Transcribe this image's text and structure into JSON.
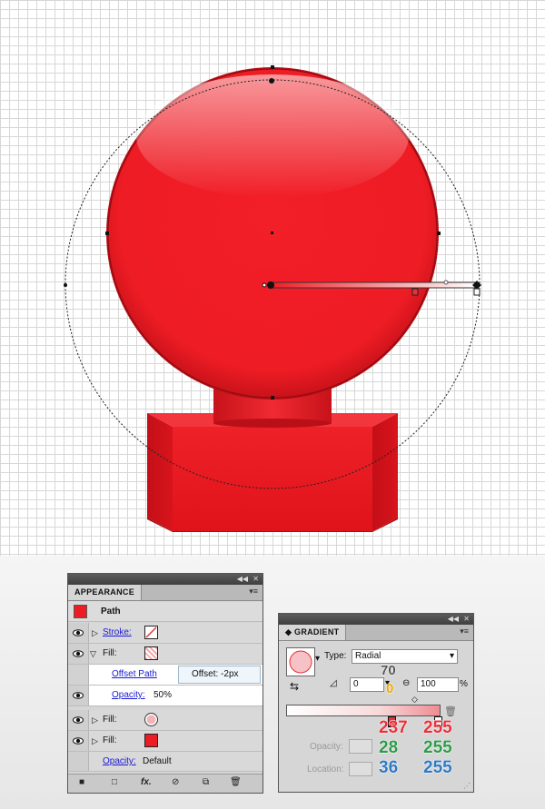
{
  "appearance": {
    "tab_title": "APPEARANCE",
    "object_label": "Path",
    "rows": {
      "stroke_label": "Stroke:",
      "fill1_label": "Fill:",
      "effect_label": "Offset Path",
      "opacity_label": "Opacity:",
      "opacity_value": "50%",
      "fill2_label": "Fill:",
      "fill3_label": "Fill:",
      "object_opacity_label": "Opacity:",
      "object_opacity_value": "Default"
    },
    "colors": {
      "fill_red": "#ed1c24"
    }
  },
  "tooltip": {
    "text": "Offset: -2px"
  },
  "gradient": {
    "tab_title": "GRADIENT",
    "type_label": "Type:",
    "type_value": "Radial",
    "angle_value": "0",
    "aspect_value": "100",
    "percent_sign": "%",
    "opacity_label": "Opacity:",
    "location_label": "Location:",
    "annotation_70": "70",
    "annotation_0": "0",
    "rgb_left": {
      "r": "237",
      "g": "28",
      "b": "36"
    },
    "rgb_right": {
      "r": "255",
      "g": "255",
      "b": "255"
    }
  }
}
